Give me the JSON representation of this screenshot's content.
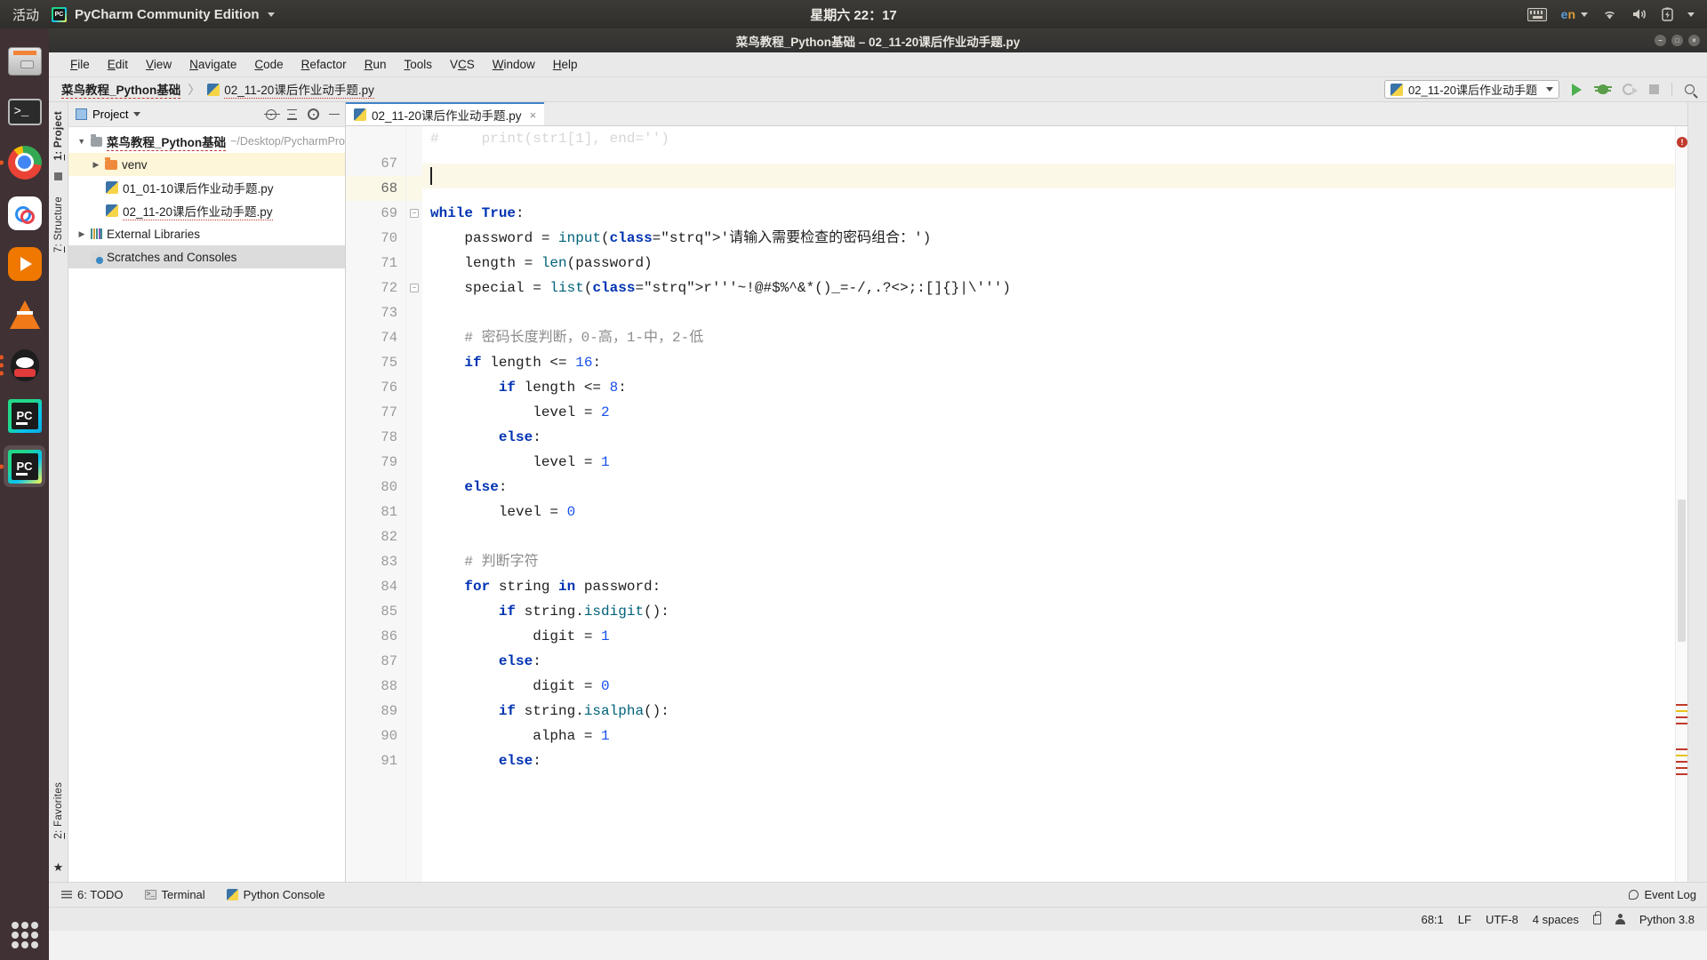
{
  "gnome": {
    "activities": "活动",
    "app_name": "PyCharm Community Edition",
    "datetime": "星期六 22：17",
    "lang": "en",
    "icons": [
      "keyboard-icon",
      "language-indicator",
      "wifi-icon",
      "volume-icon",
      "battery-icon",
      "system-menu-chevron"
    ]
  },
  "dock": {
    "items": [
      {
        "name": "files",
        "label": "Files"
      },
      {
        "name": "terminal",
        "label": "Terminal"
      },
      {
        "name": "chrome",
        "label": "Google Chrome"
      },
      {
        "name": "baidu-netdisk",
        "label": "Baidu Netdisk"
      },
      {
        "name": "media-player",
        "label": "Media Player"
      },
      {
        "name": "vlc",
        "label": "VLC media player"
      },
      {
        "name": "qq",
        "label": "QQ"
      },
      {
        "name": "pycharm-light",
        "label": "PyCharm"
      },
      {
        "name": "pycharm",
        "label": "PyCharm Community Edition"
      }
    ],
    "show_apps_label": "Show Applications"
  },
  "window": {
    "title": "菜鸟教程_Python基础 – 02_11-20课后作业动手题.py"
  },
  "menu": {
    "items": [
      "File",
      "Edit",
      "View",
      "Navigate",
      "Code",
      "Refactor",
      "Run",
      "Tools",
      "VCS",
      "Window",
      "Help"
    ]
  },
  "navbar": {
    "project": "菜鸟教程_Python基础",
    "separator": "〉",
    "file": "02_11-20课后作业动手题.py",
    "run_config": "02_11-20课后作业动手题",
    "buttons": [
      "run-button",
      "debug-button",
      "run-with-coverage-button",
      "stop-button",
      "search-everywhere-button"
    ]
  },
  "left_strip": {
    "project_tab": "1: Project",
    "structure_tab": "7: Structure",
    "favorites_tab": "2: Favorites"
  },
  "project_panel": {
    "title": "Project",
    "toolbar": [
      "locate-icon",
      "collapse-all-icon",
      "settings-gear-icon",
      "hide-icon"
    ],
    "tree": [
      {
        "label": "菜鸟教程_Python基础",
        "path": "~/Desktop/PycharmPro",
        "icon": "folder-icon",
        "expanded": true,
        "depth": 0,
        "style": "root"
      },
      {
        "label": "venv",
        "path": "",
        "icon": "folder-orange-icon",
        "expanded": false,
        "depth": 1,
        "style": "highlight"
      },
      {
        "label": "01_01-10课后作业动手题.py",
        "path": "",
        "icon": "python-file-icon",
        "depth": 1,
        "style": "file"
      },
      {
        "label": "02_11-20课后作业动手题.py",
        "path": "",
        "icon": "python-file-icon",
        "depth": 1,
        "style": "file"
      },
      {
        "label": "External Libraries",
        "path": "",
        "icon": "libraries-icon",
        "expanded": false,
        "depth": 0,
        "style": "plain"
      },
      {
        "label": "Scratches and Consoles",
        "path": "",
        "icon": "scratches-icon",
        "depth": 0,
        "style": "selected"
      }
    ]
  },
  "editor": {
    "tab_label": "02_11-20课后作业动手题.py",
    "tab_close": "×",
    "first_visible_line": 66,
    "cursor_line": 68,
    "lines": [
      {
        "no": 66,
        "text": "#     print(str1[1], end='')",
        "partial": true
      },
      {
        "no": 67,
        "text": ""
      },
      {
        "no": 68,
        "text": "",
        "current": true
      },
      {
        "no": 69,
        "text": "while True:",
        "fold": "open"
      },
      {
        "no": 70,
        "text": "    password = input('请输入需要检查的密码组合：')"
      },
      {
        "no": 71,
        "text": "    length = len(password)"
      },
      {
        "no": 72,
        "text": "    special = list(r'''~!@#$%^&*()_=-/,.?<>;:[]{}|\\''')",
        "fold": "open"
      },
      {
        "no": 73,
        "text": ""
      },
      {
        "no": 74,
        "text": "    # 密码长度判断，0-高，1-中，2-低"
      },
      {
        "no": 75,
        "text": "    if length <= 16:"
      },
      {
        "no": 76,
        "text": "        if length <= 8:"
      },
      {
        "no": 77,
        "text": "            level = 2"
      },
      {
        "no": 78,
        "text": "        else:"
      },
      {
        "no": 79,
        "text": "            level = 1"
      },
      {
        "no": 80,
        "text": "    else:"
      },
      {
        "no": 81,
        "text": "        level = 0"
      },
      {
        "no": 82,
        "text": ""
      },
      {
        "no": 83,
        "text": "    # 判断字符"
      },
      {
        "no": 84,
        "text": "    for string in password:"
      },
      {
        "no": 85,
        "text": "        if string.isdigit():"
      },
      {
        "no": 86,
        "text": "            digit = 1"
      },
      {
        "no": 87,
        "text": "        else:"
      },
      {
        "no": 88,
        "text": "            digit = 0"
      },
      {
        "no": 89,
        "text": "        if string.isalpha():"
      },
      {
        "no": 90,
        "text": "            alpha = 1"
      },
      {
        "no": 91,
        "text": "        else:"
      }
    ]
  },
  "bottom_bar": {
    "todo": "6: TODO",
    "terminal": "Terminal",
    "python_console": "Python Console",
    "event_log": "Event Log"
  },
  "status_bar": {
    "position": "68:1",
    "line_sep": "LF",
    "encoding": "UTF-8",
    "indent": "4 spaces",
    "interpreter": "Python 3.8"
  },
  "colors": {
    "accent": "#4083c9",
    "run_green": "#4caf50",
    "keyword_blue": "#0033b3",
    "string_teal": "#008080",
    "comment_gray": "#8c8c8c",
    "highlight_row": "#fcf8e8",
    "error_red": "#c0392b"
  }
}
